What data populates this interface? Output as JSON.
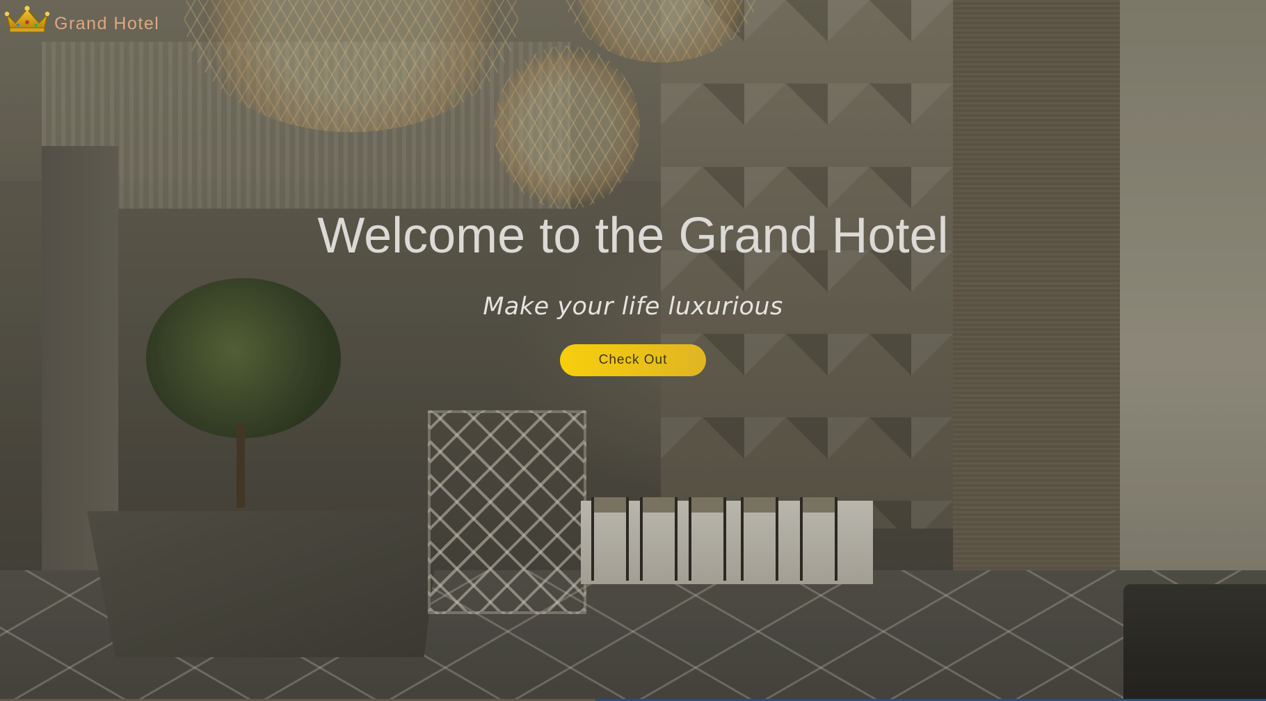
{
  "brand": {
    "name": "Grand Hotel",
    "logo_icon": "crown-icon"
  },
  "hero": {
    "headline": "Welcome to the Grand Hotel",
    "tagline": "Make your life luxurious",
    "cta_label": "Check Out",
    "background_image": "hotel-lobby-photo"
  },
  "colors": {
    "brand_text": "#e0a77f",
    "cta_gradient_start": "#f7cf0c",
    "cta_gradient_end": "#e0b523",
    "headline": "#dcdad6"
  }
}
